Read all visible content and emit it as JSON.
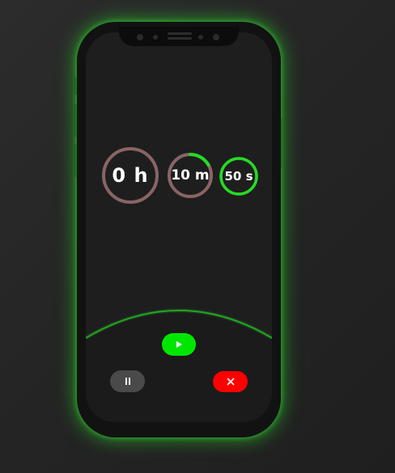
{
  "timer": {
    "hours": {
      "label": "0 h",
      "progress": 0
    },
    "minutes": {
      "label": "10 m",
      "progress": 0.167
    },
    "seconds": {
      "label": "50 s",
      "progress": 1.0
    }
  },
  "controls": {
    "play": {
      "icon": "play-icon",
      "color": "#00e600"
    },
    "pause": {
      "icon": "pause-icon",
      "color": "#4a4a4a"
    },
    "cancel": {
      "icon": "close-icon",
      "color": "#ff0000"
    }
  },
  "colors": {
    "accent": "#22dd22",
    "ring_track": "#8a6464",
    "screen": "#1e1e1e"
  }
}
